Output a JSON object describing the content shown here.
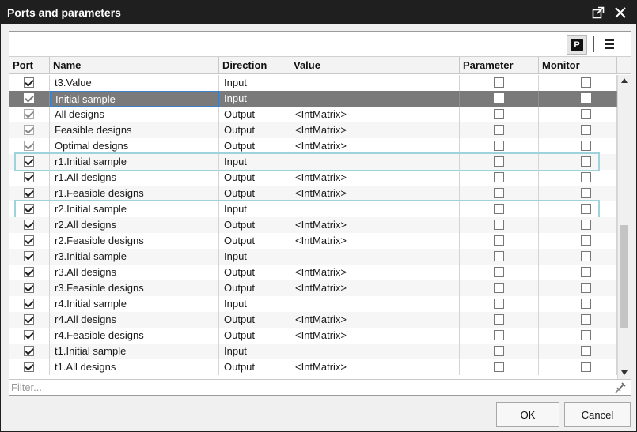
{
  "window": {
    "title": "Ports and parameters"
  },
  "toolbar": {
    "p_label": "P"
  },
  "columns": [
    "Port",
    "Name",
    "Direction",
    "Value",
    "Parameter",
    "Monitor"
  ],
  "rows": [
    {
      "port": true,
      "dim": false,
      "name": "t3.Value",
      "direction": "Input",
      "value": "",
      "parameter": false,
      "monitor": false
    },
    {
      "port": true,
      "dim": true,
      "name": "Initial sample",
      "direction": "Input",
      "value": "",
      "parameter": false,
      "monitor": false,
      "selected": true
    },
    {
      "port": true,
      "dim": true,
      "name": "All designs",
      "direction": "Output",
      "value": "<IntMatrix>",
      "parameter": false,
      "monitor": false
    },
    {
      "port": true,
      "dim": true,
      "name": "Feasible designs",
      "direction": "Output",
      "value": "<IntMatrix>",
      "parameter": false,
      "monitor": false
    },
    {
      "port": true,
      "dim": true,
      "name": "Optimal designs",
      "direction": "Output",
      "value": "<IntMatrix>",
      "parameter": false,
      "monitor": false
    },
    {
      "port": true,
      "dim": false,
      "name": "r1.Initial sample",
      "direction": "Input",
      "value": "",
      "parameter": false,
      "monitor": false,
      "highlight": true
    },
    {
      "port": true,
      "dim": false,
      "name": "r1.All designs",
      "direction": "Output",
      "value": "<IntMatrix>",
      "parameter": false,
      "monitor": false
    },
    {
      "port": true,
      "dim": false,
      "name": "r1.Feasible designs",
      "direction": "Output",
      "value": "<IntMatrix>",
      "parameter": false,
      "monitor": false
    },
    {
      "port": true,
      "dim": false,
      "name": "r2.Initial sample",
      "direction": "Input",
      "value": "",
      "parameter": false,
      "monitor": false,
      "highlight": true
    },
    {
      "port": true,
      "dim": false,
      "name": "r2.All designs",
      "direction": "Output",
      "value": "<IntMatrix>",
      "parameter": false,
      "monitor": false
    },
    {
      "port": true,
      "dim": false,
      "name": "r2.Feasible designs",
      "direction": "Output",
      "value": "<IntMatrix>",
      "parameter": false,
      "monitor": false
    },
    {
      "port": true,
      "dim": false,
      "name": "r3.Initial sample",
      "direction": "Input",
      "value": "",
      "parameter": false,
      "monitor": false
    },
    {
      "port": true,
      "dim": false,
      "name": "r3.All designs",
      "direction": "Output",
      "value": "<IntMatrix>",
      "parameter": false,
      "monitor": false
    },
    {
      "port": true,
      "dim": false,
      "name": "r3.Feasible designs",
      "direction": "Output",
      "value": "<IntMatrix>",
      "parameter": false,
      "monitor": false
    },
    {
      "port": true,
      "dim": false,
      "name": "r4.Initial sample",
      "direction": "Input",
      "value": "",
      "parameter": false,
      "monitor": false
    },
    {
      "port": true,
      "dim": false,
      "name": "r4.All designs",
      "direction": "Output",
      "value": "<IntMatrix>",
      "parameter": false,
      "monitor": false
    },
    {
      "port": true,
      "dim": false,
      "name": "r4.Feasible designs",
      "direction": "Output",
      "value": "<IntMatrix>",
      "parameter": false,
      "monitor": false
    },
    {
      "port": true,
      "dim": false,
      "name": "t1.Initial sample",
      "direction": "Input",
      "value": "",
      "parameter": false,
      "monitor": false
    },
    {
      "port": true,
      "dim": false,
      "name": "t1.All designs",
      "direction": "Output",
      "value": "<IntMatrix>",
      "parameter": false,
      "monitor": false
    }
  ],
  "filter": {
    "placeholder": "Filter..."
  },
  "buttons": {
    "ok": "OK",
    "cancel": "Cancel"
  },
  "colors": {
    "titlebar": "#1f1f1f",
    "selected_row": "#7a7a7a",
    "highlight": "#9fd3dc",
    "edit_border": "#3b7fc4"
  },
  "icons": {
    "restore": "restore-window-icon",
    "close": "close-icon",
    "menu": "hamburger-menu-icon",
    "clear": "broom-clear-icon"
  }
}
